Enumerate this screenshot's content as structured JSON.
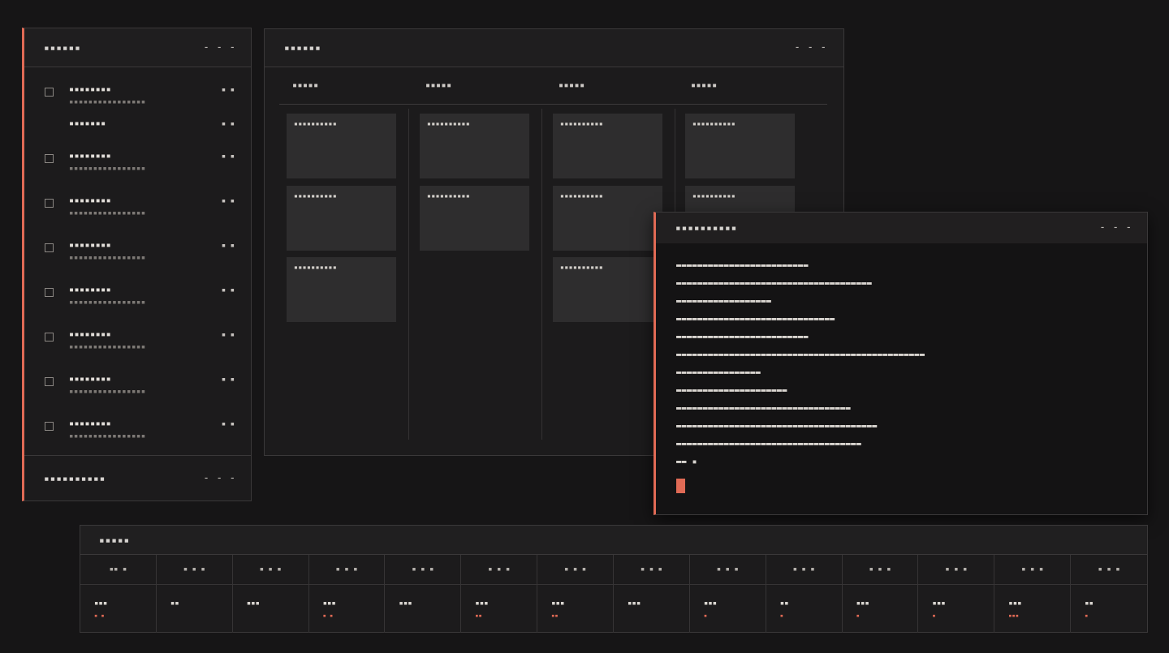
{
  "list_panel": {
    "title": "▪▪▪▪▪▪",
    "menu": "⁃ ⁃ ⁃",
    "items": [
      {
        "title": "▪▪▪▪▪▪▪▪",
        "sub": "▪▪▪▪▪▪▪▪▪▪▪▪▪▪▪▪",
        "meta": "▪ ▪",
        "checkbox": true
      },
      {
        "title": "▪▪▪▪▪▪▪",
        "sub": "",
        "meta": "▪ ▪",
        "checkbox": false
      },
      {
        "title": "▪▪▪▪▪▪▪▪",
        "sub": "▪▪▪▪▪▪▪▪▪▪▪▪▪▪▪▪",
        "meta": "▪ ▪",
        "checkbox": true
      },
      {
        "title": "▪▪▪▪▪▪▪▪",
        "sub": "▪▪▪▪▪▪▪▪▪▪▪▪▪▪▪▪",
        "meta": "▪ ▪",
        "checkbox": true
      },
      {
        "title": "▪▪▪▪▪▪▪▪",
        "sub": "▪▪▪▪▪▪▪▪▪▪▪▪▪▪▪▪",
        "meta": "▪ ▪",
        "checkbox": true
      },
      {
        "title": "▪▪▪▪▪▪▪▪",
        "sub": "▪▪▪▪▪▪▪▪▪▪▪▪▪▪▪▪",
        "meta": "▪ ▪",
        "checkbox": true
      },
      {
        "title": "▪▪▪▪▪▪▪▪",
        "sub": "▪▪▪▪▪▪▪▪▪▪▪▪▪▪▪▪",
        "meta": "▪ ▪",
        "checkbox": true
      },
      {
        "title": "▪▪▪▪▪▪▪▪",
        "sub": "▪▪▪▪▪▪▪▪▪▪▪▪▪▪▪▪",
        "meta": "▪ ▪",
        "checkbox": true
      },
      {
        "title": "▪▪▪▪▪▪▪▪",
        "sub": "▪▪▪▪▪▪▪▪▪▪▪▪▪▪▪▪",
        "meta": "▪ ▪",
        "checkbox": true
      }
    ],
    "footer_title": "▪▪▪▪▪▪▪▪▪▪",
    "footer_menu": "⁃ ⁃ ⁃"
  },
  "board": {
    "title": "▪▪▪▪▪▪",
    "menu": "⁃ ⁃ ⁃",
    "columns": [
      {
        "label": "▪▪▪▪▪",
        "cards": [
          "▪▪▪▪▪▪▪▪▪▪",
          "▪▪▪▪▪▪▪▪▪▪",
          "▪▪▪▪▪▪▪▪▪▪"
        ]
      },
      {
        "label": "▪▪▪▪▪",
        "cards": [
          "▪▪▪▪▪▪▪▪▪▪",
          "▪▪▪▪▪▪▪▪▪▪"
        ]
      },
      {
        "label": "▪▪▪▪▪",
        "cards": [
          "▪▪▪▪▪▪▪▪▪▪",
          "▪▪▪▪▪▪▪▪▪▪",
          "▪▪▪▪▪▪▪▪▪▪"
        ]
      },
      {
        "label": "▪▪▪▪▪",
        "cards": [
          "▪▪▪▪▪▪▪▪▪▪",
          "▪▪▪▪▪▪▪▪▪▪"
        ]
      }
    ]
  },
  "terminal": {
    "title": "▪▪▪▪▪▪▪▪▪▪",
    "menu": "⁃ ⁃ ⁃",
    "lines": [
      "▬▬▬▬▬▬▬▬▬▬▬▬▬▬▬▬▬▬▬▬▬▬▬▬▬",
      "▬▬▬▬▬▬▬▬▬▬▬▬▬▬▬▬▬▬▬▬▬▬▬▬▬▬▬▬▬▬▬▬▬▬▬▬▬",
      "▬▬▬▬▬▬▬▬▬▬▬▬▬▬▬▬▬▬",
      "▬▬▬▬▬▬▬▬▬▬▬▬▬▬▬▬▬▬▬▬▬▬▬▬▬▬▬▬▬▬",
      "▬▬▬▬▬▬▬▬▬▬▬▬▬▬▬▬▬▬▬▬▬▬▬▬▬",
      "▬▬▬▬▬▬▬▬▬▬▬▬▬▬▬▬▬▬▬▬▬▬▬▬▬▬▬▬▬▬▬▬▬▬▬▬▬▬▬▬▬▬▬▬▬▬▬",
      "▬▬▬▬▬▬▬▬▬▬▬▬▬▬▬▬",
      "▬▬▬▬▬▬▬▬▬▬▬▬▬▬▬▬▬▬▬▬▬",
      "▬▬▬▬▬▬▬▬▬▬▬▬▬▬▬▬▬▬▬▬▬▬▬▬▬▬▬▬▬▬▬▬▬",
      "▬▬▬▬▬▬▬▬▬▬▬▬▬▬▬▬▬▬▬▬▬▬▬▬▬▬▬▬▬▬▬▬▬▬▬▬▬▬",
      "▬▬▬▬▬▬▬▬▬▬▬▬▬▬▬▬▬▬▬▬▬▬▬▬▬▬▬▬▬▬▬▬▬▬▬",
      "▬▬ ▪"
    ]
  },
  "table": {
    "title": "▪▪▪▪▪",
    "cells": [
      {
        "head": "▪▪ ▪",
        "value": "▪▪▪",
        "sub": "▪ ▪"
      },
      {
        "head": "▪ ▪ ▪",
        "value": "▪▪",
        "sub": ""
      },
      {
        "head": "▪ ▪ ▪",
        "value": "▪▪▪",
        "sub": ""
      },
      {
        "head": "▪ ▪ ▪",
        "value": "▪▪▪",
        "sub": "▪ ▪"
      },
      {
        "head": "▪ ▪ ▪",
        "value": "▪▪▪",
        "sub": ""
      },
      {
        "head": "▪ ▪ ▪",
        "value": "▪▪▪",
        "sub": "▪▪"
      },
      {
        "head": "▪ ▪ ▪",
        "value": "▪▪▪",
        "sub": "▪▪"
      },
      {
        "head": "▪ ▪ ▪",
        "value": "▪▪▪",
        "sub": ""
      },
      {
        "head": "▪ ▪ ▪",
        "value": "▪▪▪",
        "sub": "▪"
      },
      {
        "head": "▪ ▪ ▪",
        "value": "▪▪",
        "sub": "▪"
      },
      {
        "head": "▪ ▪ ▪",
        "value": "▪▪▪",
        "sub": "▪"
      },
      {
        "head": "▪ ▪ ▪",
        "value": "▪▪▪",
        "sub": "▪"
      },
      {
        "head": "▪ ▪ ▪",
        "value": "▪▪▪",
        "sub": "▪▪▪"
      },
      {
        "head": "▪ ▪ ▪",
        "value": "▪▪",
        "sub": "▪"
      }
    ]
  },
  "colors": {
    "background": "#161516",
    "panel": "#1c1b1c",
    "accent": "#e06a55",
    "card": "#2e2d2e"
  }
}
